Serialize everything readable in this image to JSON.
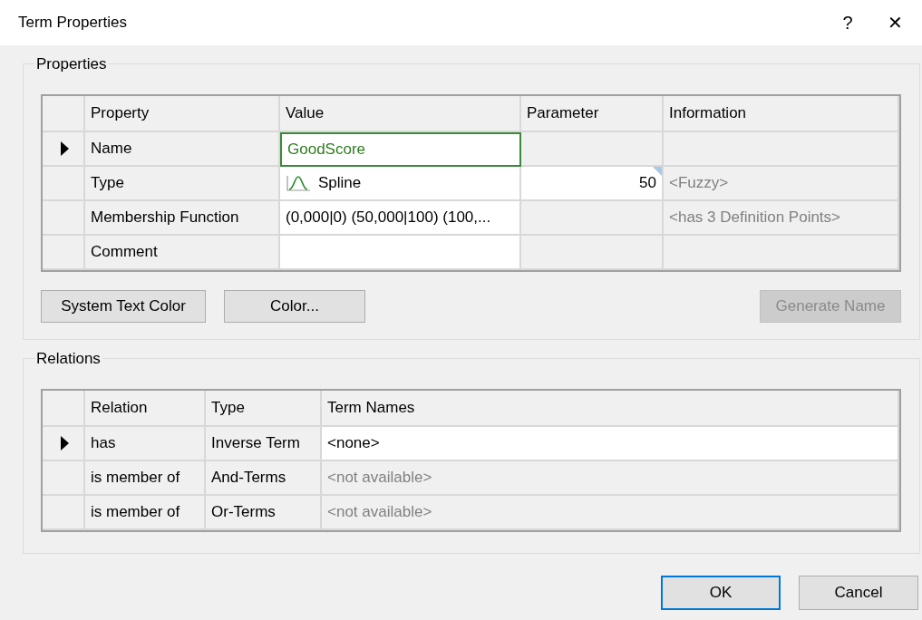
{
  "window": {
    "title": "Term Properties",
    "help": "?",
    "close": "✕"
  },
  "properties": {
    "title": "Properties",
    "columns": [
      "Property",
      "Value",
      "Parameter",
      "Information"
    ],
    "rows": [
      {
        "selected": true,
        "cells": [
          {
            "text": "Name",
            "editable": false
          },
          {
            "text": "GoodScore",
            "editable": true,
            "editing": true
          },
          {
            "editable": false
          },
          {
            "editable": false
          }
        ]
      },
      {
        "selected": false,
        "cells": [
          {
            "text": "Type",
            "editable": false
          },
          {
            "text": "Spline",
            "editable": true,
            "kind": "spline"
          },
          {
            "text": "50",
            "editable": true,
            "flagged": true
          },
          {
            "text": "<Fuzzy>",
            "editable": false,
            "dim": true
          }
        ]
      },
      {
        "selected": false,
        "cells": [
          {
            "text": "Membership Function",
            "editable": false
          },
          {
            "text": "(0,000|0) (50,000|100) (100,...",
            "editable": true
          },
          {
            "editable": false
          },
          {
            "text": "<has 3 Definition Points>",
            "editable": false,
            "dim": true
          }
        ]
      },
      {
        "selected": false,
        "cells": [
          {
            "text": "Comment",
            "editable": false
          },
          {
            "editable": true
          },
          {
            "editable": false
          },
          {
            "editable": false
          }
        ]
      }
    ],
    "buttons": [
      {
        "label": "System Text Color",
        "disabled": false
      },
      {
        "label": "Color...",
        "disabled": false
      },
      {
        "label": "Generate Name",
        "disabled": true
      }
    ]
  },
  "relations": {
    "title": "Relations",
    "columns": [
      "Relation",
      "Type",
      "Term Names"
    ],
    "rows": [
      {
        "selected": true,
        "cells": [
          {
            "text": "has",
            "editable": false
          },
          {
            "text": "Inverse Term",
            "editable": false
          },
          {
            "text": "<none>",
            "editable": true
          }
        ]
      },
      {
        "selected": false,
        "cells": [
          {
            "text": "is member of",
            "editable": false
          },
          {
            "text": "And-Terms",
            "editable": false
          },
          {
            "text": "<not available>",
            "editable": false,
            "dim": true
          }
        ]
      },
      {
        "selected": false,
        "cells": [
          {
            "text": "is member of",
            "editable": false
          },
          {
            "text": "Or-Terms",
            "editable": false
          },
          {
            "text": "<not available>",
            "editable": false,
            "dim": true
          }
        ]
      }
    ]
  },
  "buttons": [
    {
      "label": "OK",
      "default": true
    },
    {
      "label": "Cancel",
      "default": false
    }
  ]
}
